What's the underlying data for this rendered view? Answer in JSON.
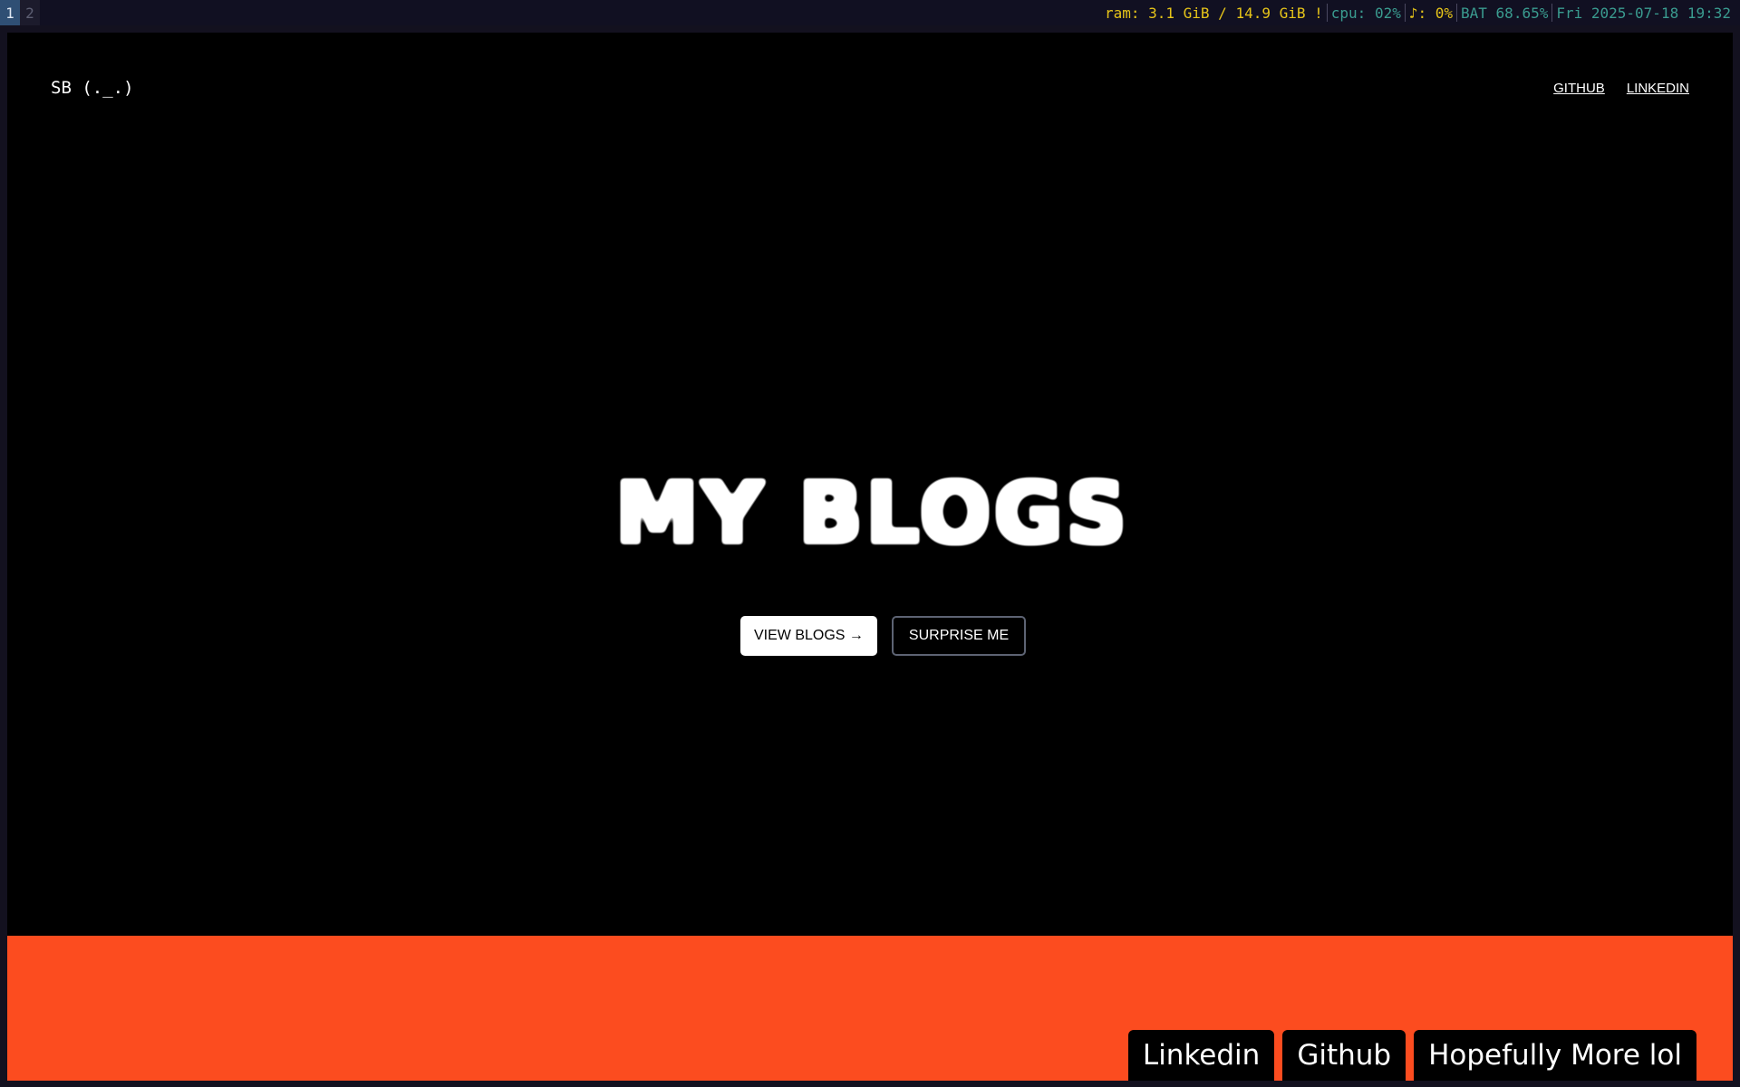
{
  "statusbar": {
    "workspaces": [
      "1",
      "2"
    ],
    "ram": "ram: 3.1 GiB / 14.9 GiB !",
    "cpu": "cpu: 02%",
    "volume": "♪: 0%",
    "battery": "BAT 68.65%",
    "datetime": "Fri 2025-07-18 19:32",
    "colors": {
      "ram": "#e6c419",
      "cpu": "#3a9b8f",
      "volume": "#e6c419",
      "battery": "#3a9b8f",
      "datetime": "#3a9b8f"
    }
  },
  "nav": {
    "logo": "SB (._.)",
    "links": [
      "GITHUB",
      "LINKEDIN"
    ]
  },
  "hero": {
    "title": "MY BLOGS",
    "primary_button": "VIEW BLOGS →",
    "secondary_button": "SURPRISE ME"
  },
  "footer": {
    "background": "#fc4c1f",
    "links": [
      "Linkedin",
      "Github",
      "Hopefully More lol"
    ]
  }
}
